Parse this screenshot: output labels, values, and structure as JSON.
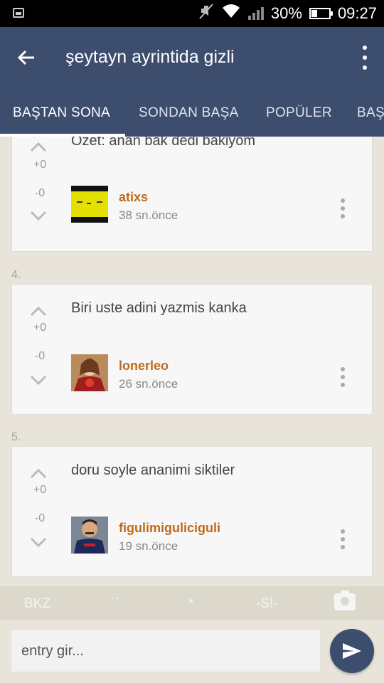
{
  "status_bar": {
    "battery": "30%",
    "time": "09:27"
  },
  "app_bar": {
    "title": "şeytayn ayrintida gizli"
  },
  "tabs": [
    {
      "label": "BAŞTAN SONA",
      "active": true
    },
    {
      "label": "SONDAN BAŞA",
      "active": false
    },
    {
      "label": "POPÜLER",
      "active": false
    },
    {
      "label": "BAŞ",
      "active": false
    }
  ],
  "entries": [
    {
      "number": "",
      "text": "Özet: anan bak dedi bakiyom",
      "up_score": "+0",
      "down_score": "-0",
      "author": "atixs",
      "time": "38 sn.önce",
      "avatar": "yellow-banner"
    },
    {
      "number": "4.",
      "text": "Biri uste adini yazmis kanka",
      "up_score": "+0",
      "down_score": "-0",
      "author": "lonerleo",
      "time": "26 sn.önce",
      "avatar": "portrait"
    },
    {
      "number": "5.",
      "text": "doru soyle ananimi siktiler",
      "up_score": "+0",
      "down_score": "-0",
      "author": "figulimiguliciguli",
      "time": "19 sn.önce",
      "avatar": "player"
    }
  ],
  "format_bar": {
    "bkz": "BKZ",
    "backticks": "``",
    "star": "*",
    "spoiler": "-S!-"
  },
  "input": {
    "placeholder": "entry gir..."
  },
  "colors": {
    "app_bar": "#3c4d6e",
    "author": "#c06a1a",
    "background": "#e8e4da"
  }
}
